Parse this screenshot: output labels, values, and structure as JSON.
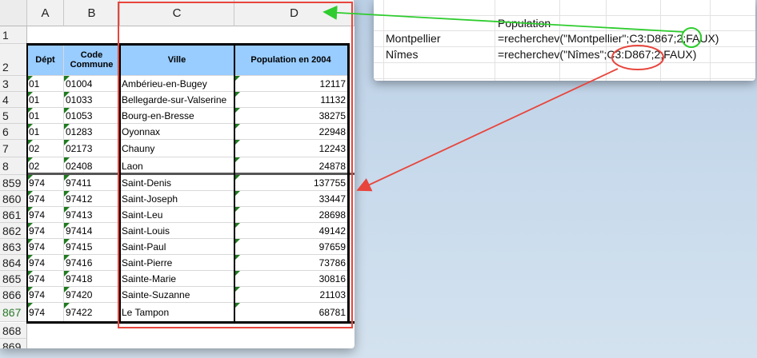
{
  "spreadsheet": {
    "columns": [
      "A",
      "B",
      "C",
      "D"
    ],
    "header_row": {
      "row": "2",
      "dept": "Dépt",
      "code": "Code Commune",
      "ville": "Ville",
      "population": "Population en 2004"
    },
    "row1": "1",
    "rows": [
      {
        "row": "3",
        "dept": "01",
        "code": "01004",
        "ville": "Ambérieu-en-Bugey",
        "population": "12117"
      },
      {
        "row": "4",
        "dept": "01",
        "code": "01033",
        "ville": "Bellegarde-sur-Valserine",
        "population": "11132"
      },
      {
        "row": "5",
        "dept": "01",
        "code": "01053",
        "ville": "Bourg-en-Bresse",
        "population": "38275"
      },
      {
        "row": "6",
        "dept": "01",
        "code": "01283",
        "ville": "Oyonnax",
        "population": "22948"
      },
      {
        "row": "7",
        "dept": "02",
        "code": "02173",
        "ville": "Chauny",
        "population": "12243"
      },
      {
        "row": "8",
        "dept": "02",
        "code": "02408",
        "ville": "Laon",
        "population": "24878"
      },
      {
        "row": "859",
        "dept": "974",
        "code": "97411",
        "ville": "Saint-Denis",
        "population": "137755"
      },
      {
        "row": "860",
        "dept": "974",
        "code": "97412",
        "ville": "Saint-Joseph",
        "population": "33447"
      },
      {
        "row": "861",
        "dept": "974",
        "code": "97413",
        "ville": "Saint-Leu",
        "population": "28698"
      },
      {
        "row": "862",
        "dept": "974",
        "code": "97414",
        "ville": "Saint-Louis",
        "population": "49142"
      },
      {
        "row": "863",
        "dept": "974",
        "code": "97415",
        "ville": "Saint-Paul",
        "population": "97659"
      },
      {
        "row": "864",
        "dept": "974",
        "code": "97416",
        "ville": "Saint-Pierre",
        "population": "73786"
      },
      {
        "row": "865",
        "dept": "974",
        "code": "97418",
        "ville": "Sainte-Marie",
        "population": "30816"
      },
      {
        "row": "866",
        "dept": "974",
        "code": "97420",
        "ville": "Sainte-Suzanne",
        "population": "21103"
      },
      {
        "row": "867",
        "dept": "974",
        "code": "97422",
        "ville": "Le Tampon",
        "population": "68781"
      }
    ],
    "trailing_rows": [
      "868",
      "869"
    ]
  },
  "popup": {
    "header": "Population",
    "rows": [
      {
        "city": "Montpellier",
        "formula": "=recherchev(\"Montpellier\";C3:D867;2;FAUX)"
      },
      {
        "city": "Nîmes",
        "formula": "=recherchev(\"Nîmes\";C3:D867;2;FAUX)"
      }
    ]
  },
  "colors": {
    "header_fill": "#99ccff",
    "red_annotation": "#e8453c",
    "green_annotation": "#2ecc2e"
  }
}
